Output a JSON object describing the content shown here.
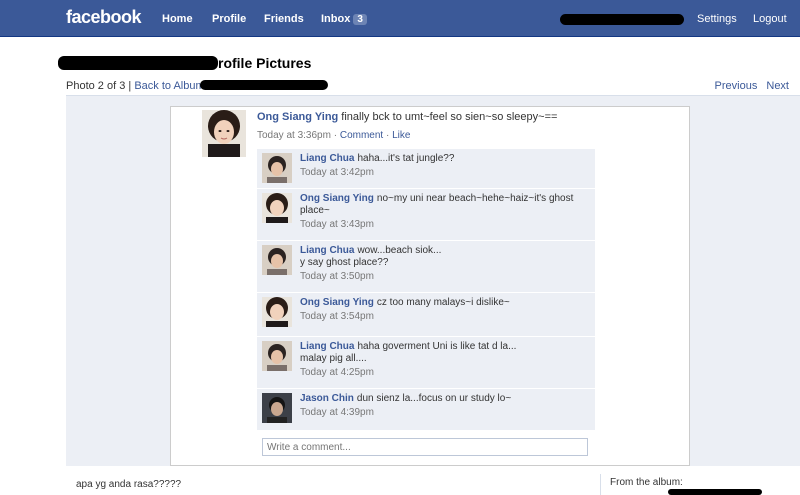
{
  "header": {
    "logo": "facebook",
    "nav": [
      "Home",
      "Profile",
      "Friends"
    ],
    "inbox_label": "Inbox",
    "inbox_count": "3",
    "settings": "Settings",
    "logout": "Logout"
  },
  "page": {
    "title": "rofile Pictures",
    "photo_position": "Photo 2 of 3",
    "separator": "|",
    "back_link": "Back to Album",
    "previous": "Previous",
    "next": "Next"
  },
  "post": {
    "author": "Ong Siang Ying",
    "text": "finally bck to umt~feel so sien~so sleepy~==",
    "time": "Today at 3:36pm",
    "dot": "·",
    "comment_link": "Comment",
    "like_link": "Like"
  },
  "comments": [
    {
      "author": "Liang Chua",
      "text": "haha...it's tat jungle??",
      "time": "Today at 3:42pm"
    },
    {
      "author": "Ong Siang Ying",
      "text": "no~my uni near beach~hehe~haiz~it's ghost place~",
      "time": "Today at 3:43pm"
    },
    {
      "author": "Liang Chua",
      "text": "wow...beach siok...",
      "text2": "y say ghost place??",
      "time": "Today at 3:50pm"
    },
    {
      "author": "Ong Siang Ying",
      "text": "cz too many malays~i dislike~",
      "time": "Today at 3:54pm"
    },
    {
      "author": "Liang Chua",
      "text": "haha goverment Uni is like tat d la...",
      "text2": "malay pig all....",
      "time": "Today at 4:25pm"
    },
    {
      "author": "Jason Chin",
      "text": "dun sienz la...focus on ur study lo~",
      "time": "Today at 4:39pm"
    }
  ],
  "comment_input": {
    "placeholder": "Write a comment..."
  },
  "footer": {
    "caption": "apa yg anda rasa?????",
    "from_album": "From the album:"
  }
}
